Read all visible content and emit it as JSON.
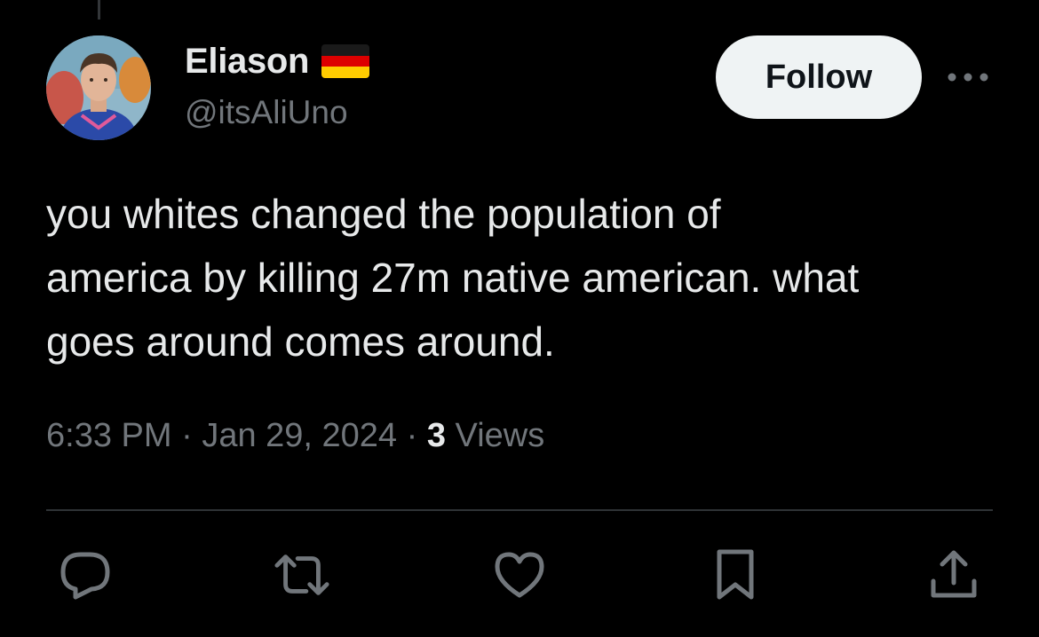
{
  "author": {
    "display_name": "Eliason",
    "flag": "germany-flag",
    "handle": "@itsAliUno",
    "avatar": "profile-photo"
  },
  "header": {
    "follow_label": "Follow",
    "more_icon": "more-horizontal-icon"
  },
  "tweet": {
    "text": "you whites changed the population of\namerica by killing 27m native american. what\ngoes around comes around.",
    "time": "6:33 PM",
    "date": "Jan 29, 2024",
    "separator": "·",
    "views_count": "3",
    "views_label": "Views"
  },
  "actions": [
    {
      "icon": "reply-icon"
    },
    {
      "icon": "retweet-icon"
    },
    {
      "icon": "like-icon"
    },
    {
      "icon": "bookmark-icon"
    },
    {
      "icon": "share-icon"
    }
  ],
  "colors": {
    "background": "#000000",
    "text_primary": "#e7e9ea",
    "text_secondary": "#71767b",
    "button_bg": "#eff3f4",
    "divider": "#2f3336"
  }
}
